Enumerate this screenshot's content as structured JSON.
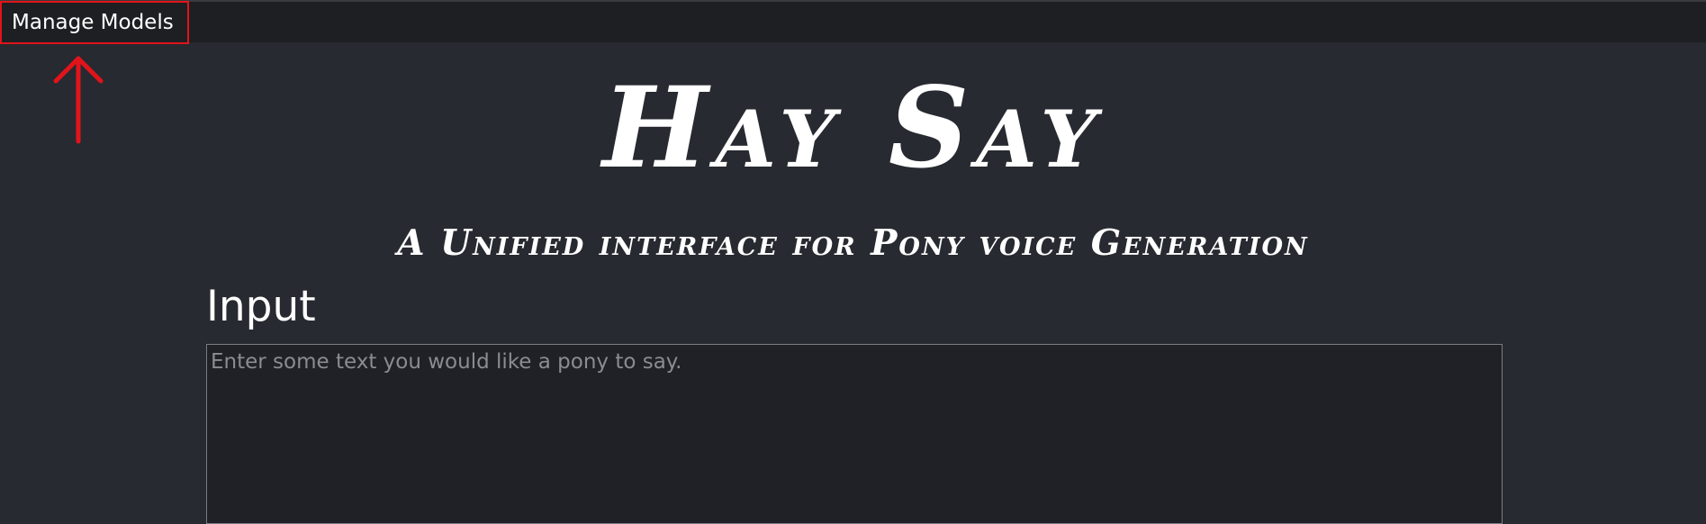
{
  "menu": {
    "manage_models_label": "Manage Models"
  },
  "header": {
    "title": "Hay Say",
    "subtitle": "A Unified interface for Pony voice Generation"
  },
  "input_section": {
    "heading": "Input",
    "text_placeholder": "Enter some text you would like a pony to say.",
    "text_value": ""
  },
  "annotation": {
    "arrow_icon": "up-arrow-icon",
    "highlight_color": "#e0141a"
  },
  "colors": {
    "background": "#272a30",
    "topbar": "#1e1f22",
    "text": "#ffffff",
    "input_background": "#1f2126"
  }
}
